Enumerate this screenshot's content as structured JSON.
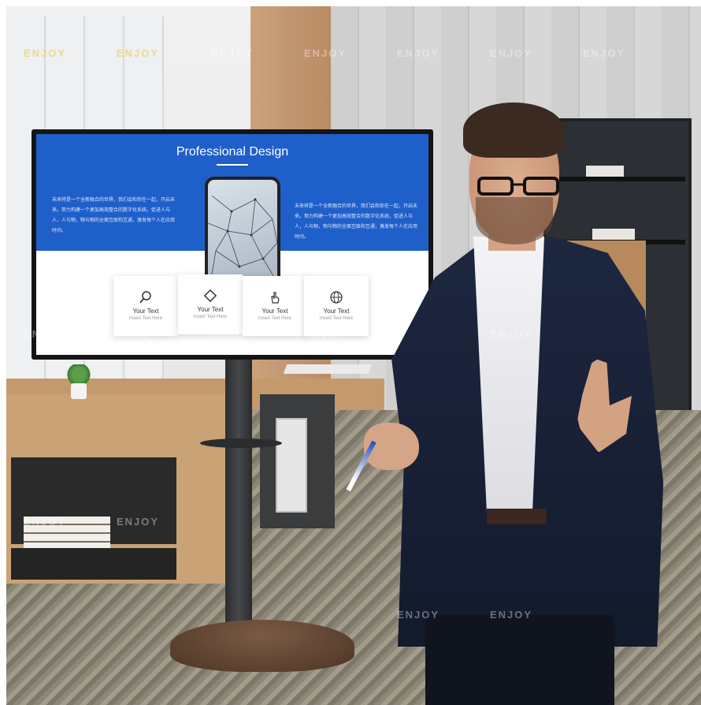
{
  "screen": {
    "title": "Professional Design",
    "paragraph_left": "未来将是一个全新融合的世界，我们会和你在一起，开启未来。努力构建一个更加高效整合的数字化系统，促进人与人，人与物，物与物的全面互联和互通，激发每个人在应用时间。",
    "paragraph_right": "未来将是一个全新融合的世界，我们会和你在一起，开启未来。努力构建一个更加高效整合的数字化系统，促进人与人，人与物，物与物的全面互联和互通，激发每个人在应用时间。",
    "cards": [
      {
        "icon": "search-icon",
        "title": "Your Text",
        "subtitle": "Insert Text Here"
      },
      {
        "icon": "diamond-icon",
        "title": "Your Text",
        "subtitle": "Insert Text Here"
      },
      {
        "icon": "hand-icon",
        "title": "Your Text",
        "subtitle": "Insert Text Here"
      },
      {
        "icon": "globe-icon",
        "title": "Your Text",
        "subtitle": "Insert Text Here"
      }
    ],
    "accent_color": "#1f5fc9"
  },
  "watermark": {
    "text": "ENJOY"
  }
}
